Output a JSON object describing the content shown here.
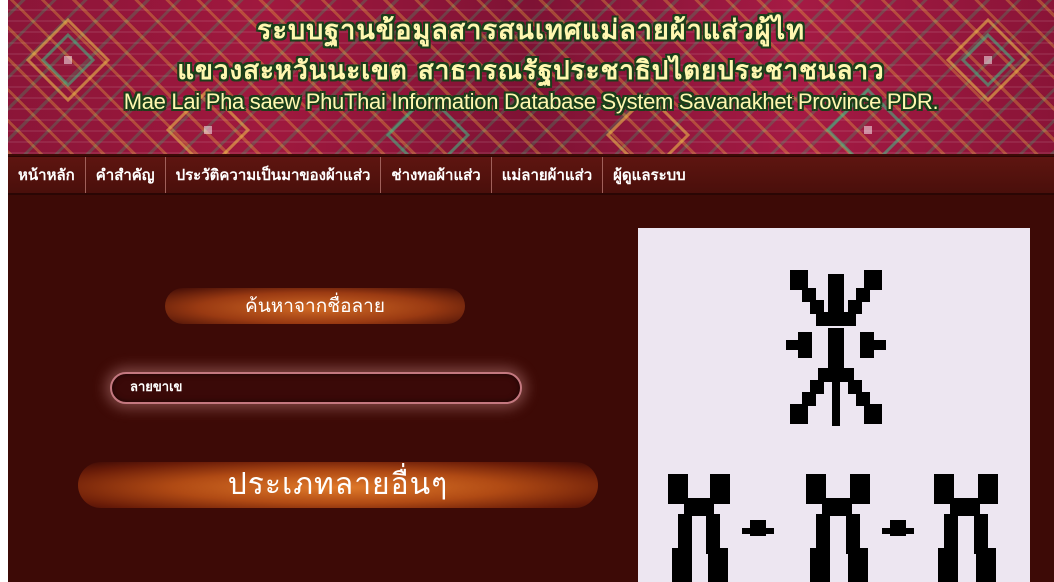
{
  "banner": {
    "title_line1": "ระบบฐานข้อมูลสารสนเทศแม่ลายผ้าแส่วผู้ไท",
    "title_line2": "แขวงสะหวันนะเขต สาธารณรัฐประชาธิปไตยประชาชนลาว",
    "title_line3": "Mae Lai Pha saew PhuThai Information Database System Savanakhet Province PDR."
  },
  "nav": {
    "items": [
      {
        "label": "หน้าหลัก"
      },
      {
        "label": "คำสำคัญ"
      },
      {
        "label": "ประวัติความเป็นมาของผ้าแส่ว"
      },
      {
        "label": "ช่างทอผ้าแส่ว"
      },
      {
        "label": "แม่ลายผ้าแส่ว"
      },
      {
        "label": "ผู้ดูแลระบบ"
      }
    ]
  },
  "search": {
    "label": "ค้นหาจากชื่อลาย",
    "value": "ลายขาเข"
  },
  "other_types_button": "ประเภทลายอื่นๆ",
  "colors": {
    "background": "#3d0a06",
    "nav_background": "#4a0f0b",
    "accent_orange": "#d06a25",
    "pattern_panel": "#ede6f1",
    "pattern_ink": "#000000"
  }
}
